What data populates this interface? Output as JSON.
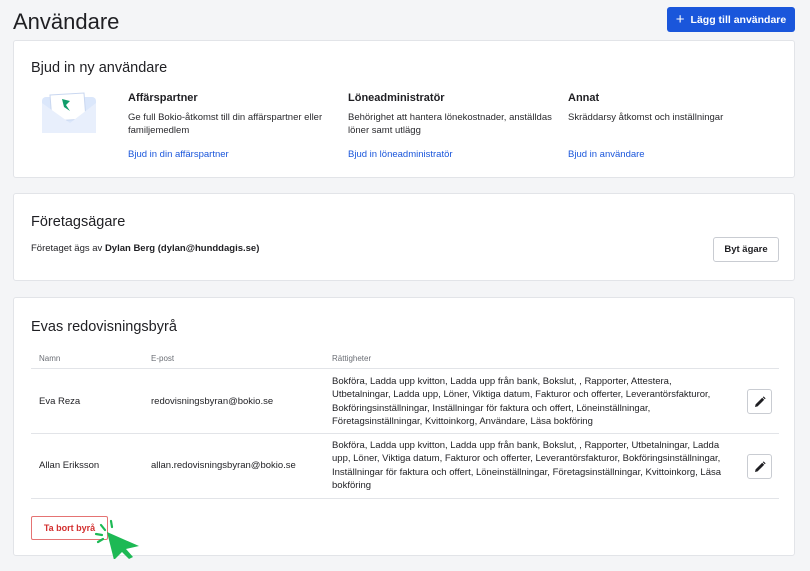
{
  "header": {
    "title": "Användare",
    "add_user_label": "Lägg till användare"
  },
  "invite": {
    "title": "Bjud in ny användare",
    "columns": [
      {
        "heading": "Affärspartner",
        "description": "Ge full Bokio-åtkomst till din affärspartner eller familjemedlem",
        "link": "Bjud in din affärspartner"
      },
      {
        "heading": "Löneadministratör",
        "description": "Behörighet att hantera lönekostnader, anställdas löner samt utlägg",
        "link": "Bjud in löneadministratör"
      },
      {
        "heading": "Annat",
        "description": "Skräddarsy åtkomst och inställningar",
        "link": "Bjud in användare"
      }
    ]
  },
  "owner": {
    "title": "Företagsägare",
    "prefix": "Företaget ägs av",
    "name": "Dylan Berg (dylan@hunddagis.se)",
    "change_label": "Byt ägare"
  },
  "agency": {
    "title": "Evas redovisningsbyrå",
    "headers": {
      "name": "Namn",
      "email": "E-post",
      "permissions": "Rättigheter"
    },
    "rows": [
      {
        "name": "Eva Reza",
        "email": "redovisningsbyran@bokio.se",
        "permissions": "Bokföra, Ladda upp kvitton, Ladda upp från bank, Bokslut, , Rapporter, Attestera, Utbetalningar, Ladda upp, Löner, Viktiga datum, Fakturor och offerter, Leverantörsfakturor, Bokföringsinställningar, Inställningar för faktura och offert, Löneinställningar, Företagsinställningar, Kvittoinkorg, Användare, Läsa bokföring"
      },
      {
        "name": "Allan Eriksson",
        "email": "allan.redovisningsbyran@bokio.se",
        "permissions": "Bokföra, Ladda upp kvitton, Ladda upp från bank, Bokslut, , Rapporter, Utbetalningar, Ladda upp, Löner, Viktiga datum, Fakturor och offerter, Leverantörsfakturor, Bokföringsinställningar, Inställningar för faktura och offert, Löneinställningar, Företagsinställningar, Kvittoinkorg, Läsa bokföring"
      }
    ],
    "remove_label": "Ta bort byrå"
  },
  "colors": {
    "primary": "#1a56db",
    "danger": "#d32f2f",
    "cursor": "#1db954"
  },
  "icons": {
    "add": "plus-icon",
    "edit": "pencil-icon",
    "cursor": "hand-pointer-icon"
  }
}
